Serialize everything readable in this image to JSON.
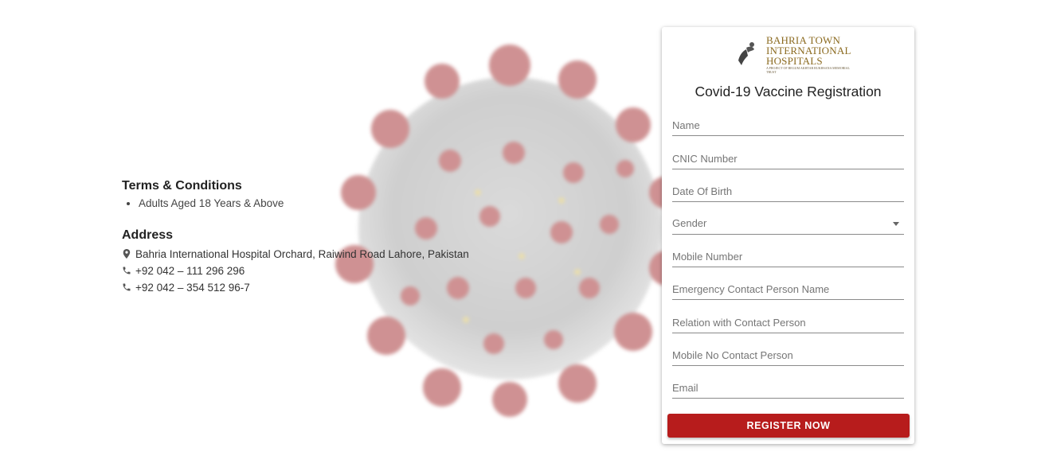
{
  "terms": {
    "title": "Terms & Conditions",
    "items": [
      "Adults Aged 18 Years & Above"
    ]
  },
  "address": {
    "title": "Address",
    "location": "Bahria International Hospital Orchard, Raiwind Road Lahore, Pakistan",
    "phone1": "+92 042 – 111 296 296",
    "phone2": "+92 042 – 354 512 96-7"
  },
  "form": {
    "logo_text_line1": "BAHRIA TOWN",
    "logo_text_line2": "INTERNATIONAL",
    "logo_text_line3": "HOSPITALS",
    "logo_subtext": "A PROJECT OF BEGUM AKHTAR RUKHSANA MEMORIAL TRUST",
    "title": "Covid-19 Vaccine Registration",
    "fields": {
      "name": "Name",
      "cnic": "CNIC Number",
      "dob": "Date Of Birth",
      "gender": "Gender",
      "mobile": "Mobile Number",
      "emergency_name": "Emergency Contact Person Name",
      "relation": "Relation with Contact Person",
      "emergency_mobile": "Mobile No Contact Person",
      "email": "Email"
    },
    "submit_label": "REGISTER NOW"
  },
  "colors": {
    "accent": "#b71c1c",
    "logo_gold": "#8b6a1f",
    "logo_red": "#c0272d"
  },
  "icons": {
    "location": "map-pin-icon",
    "phone": "phone-icon",
    "dropdown": "caret-down-icon"
  }
}
